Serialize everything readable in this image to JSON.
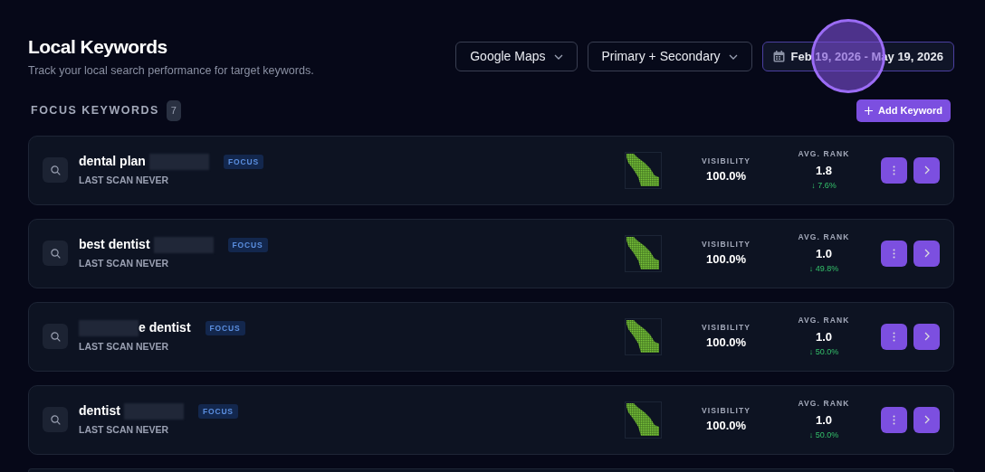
{
  "header": {
    "title": "Local Keywords",
    "subtitle": "Track your local search performance for target keywords."
  },
  "filters": [
    {
      "kind": "dropdown",
      "label": "Google Maps"
    },
    {
      "kind": "dropdown",
      "label": "Primary + Secondary"
    },
    {
      "kind": "date",
      "label": "Feb 19, 2026 - May 19, 2026"
    }
  ],
  "section": {
    "title": "FOCUS KEYWORDS",
    "count": "7",
    "add_button": "Add Keyword"
  },
  "keywords": [
    {
      "name": "dental plan",
      "redacted_before": false,
      "redacted_after": true,
      "badge": "FOCUS",
      "last_scan": "LAST SCAN NEVER",
      "visibility_label": "VISIBILITY",
      "visibility": "100.0%",
      "rank_label": "AVG. RANK",
      "rank": "1.8",
      "change": "↓ 7.6%"
    },
    {
      "name": "best dentist",
      "redacted_before": false,
      "redacted_after": true,
      "badge": "FOCUS",
      "last_scan": "LAST SCAN NEVER",
      "visibility_label": "VISIBILITY",
      "visibility": "100.0%",
      "rank_label": "AVG. RANK",
      "rank": "1.0",
      "change": "↓ 49.8%"
    },
    {
      "name": "e dentist",
      "redacted_before": true,
      "redacted_after": false,
      "badge": "FOCUS",
      "last_scan": "LAST SCAN NEVER",
      "visibility_label": "VISIBILITY",
      "visibility": "100.0%",
      "rank_label": "AVG. RANK",
      "rank": "1.0",
      "change": "↓ 50.0%"
    },
    {
      "name": "dentist",
      "redacted_before": false,
      "redacted_after": true,
      "badge": "FOCUS",
      "last_scan": "LAST SCAN NEVER",
      "visibility_label": "VISIBILITY",
      "visibility": "100.0%",
      "rank_label": "AVG. RANK",
      "rank": "1.0",
      "change": "↓ 50.0%"
    }
  ]
}
